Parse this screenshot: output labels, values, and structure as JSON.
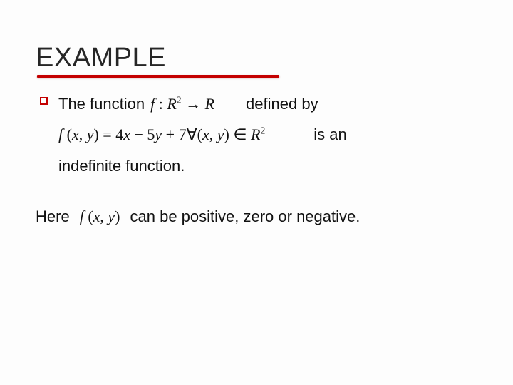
{
  "title": "EXAMPLE",
  "para1": {
    "bullet_lead": "The function",
    "func_decl": {
      "f": "f",
      "colon": " : ",
      "R": "R",
      "sup2": "2",
      "arrow": " → ",
      "R2": "R"
    },
    "after_decl": "defined by",
    "func_def": {
      "lhs_f": "f",
      "lhs_open": " (",
      "lhs_x": "x",
      "lhs_comma": ", ",
      "lhs_y": "y",
      "lhs_close": ") = ",
      "rhs_1": "4",
      "rhs_x": "x",
      "rhs_minus": " − 5",
      "rhs_y": "y",
      "rhs_plus": " + 7",
      "forall": "∀(",
      "fa_x": "x",
      "fa_comma": ", ",
      "fa_y": "y",
      "fa_close": ") ∈ ",
      "fa_R": "R",
      "fa_sup": "2"
    },
    "after_def": "is an",
    "tail": "indefinite function."
  },
  "para2": {
    "lead": "Here",
    "fxy": {
      "f": "f",
      "open": " (",
      "x": "x",
      "comma": ", ",
      "y": "y",
      "close": ")"
    },
    "tail": "can be positive, zero or negative."
  }
}
